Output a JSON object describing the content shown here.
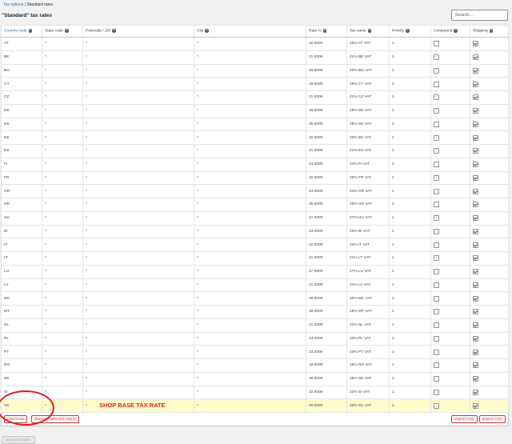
{
  "breadcrumb": {
    "parent": "Tax options",
    "separator": "|",
    "current": "Standard rates"
  },
  "title": "\"Standard\" tax rates",
  "search": {
    "placeholder": "Search..."
  },
  "columns": {
    "country": "Country code",
    "state": "State code",
    "postcode": "Postcode / ZIP",
    "city": "City",
    "rate": "Rate %",
    "name": "Tax name",
    "priority": "Priority",
    "compound": "Compound",
    "shipping": "Shipping"
  },
  "rows": [
    {
      "country": "AT",
      "state": "*",
      "postcode": "*",
      "city": "*",
      "rate": "20.0000",
      "name": "20% AT VAT",
      "priority": "1",
      "compound": false,
      "shipping": true
    },
    {
      "country": "BE",
      "state": "*",
      "postcode": "*",
      "city": "*",
      "rate": "21.0000",
      "name": "21% BE VAT",
      "priority": "1",
      "compound": false,
      "shipping": true
    },
    {
      "country": "BG",
      "state": "*",
      "postcode": "*",
      "city": "*",
      "rate": "20.0000",
      "name": "20% BG VAT",
      "priority": "1",
      "compound": false,
      "shipping": true
    },
    {
      "country": "CY",
      "state": "*",
      "postcode": "*",
      "city": "*",
      "rate": "19.0000",
      "name": "19% CY VAT",
      "priority": "1",
      "compound": false,
      "shipping": true
    },
    {
      "country": "CZ",
      "state": "*",
      "postcode": "*",
      "city": "*",
      "rate": "21.0000",
      "name": "21% CZ VAT",
      "priority": "1",
      "compound": false,
      "shipping": true
    },
    {
      "country": "DE",
      "state": "*",
      "postcode": "*",
      "city": "*",
      "rate": "19.0000",
      "name": "19% DE VAT",
      "priority": "1",
      "compound": false,
      "shipping": true
    },
    {
      "country": "DK",
      "state": "*",
      "postcode": "*",
      "city": "*",
      "rate": "25.0000",
      "name": "25% DK VAT",
      "priority": "1",
      "compound": false,
      "shipping": true
    },
    {
      "country": "EE",
      "state": "*",
      "postcode": "*",
      "city": "*",
      "rate": "20.0000",
      "name": "20% EE VAT",
      "priority": "1",
      "compound": false,
      "shipping": true
    },
    {
      "country": "ES",
      "state": "*",
      "postcode": "*",
      "city": "*",
      "rate": "21.0000",
      "name": "21% ES VAT",
      "priority": "1",
      "compound": false,
      "shipping": true
    },
    {
      "country": "FI",
      "state": "*",
      "postcode": "*",
      "city": "*",
      "rate": "24.0000",
      "name": "24% FI VAT",
      "priority": "1",
      "compound": false,
      "shipping": true
    },
    {
      "country": "FR",
      "state": "*",
      "postcode": "*",
      "city": "*",
      "rate": "20.0000",
      "name": "20% FR VAT",
      "priority": "1",
      "compound": false,
      "shipping": true
    },
    {
      "country": "GR",
      "state": "*",
      "postcode": "*",
      "city": "*",
      "rate": "24.0000",
      "name": "24% GR VAT",
      "priority": "1",
      "compound": false,
      "shipping": true
    },
    {
      "country": "HR",
      "state": "*",
      "postcode": "*",
      "city": "*",
      "rate": "25.0000",
      "name": "25% HR VAT",
      "priority": "1",
      "compound": false,
      "shipping": true
    },
    {
      "country": "HU",
      "state": "*",
      "postcode": "*",
      "city": "*",
      "rate": "27.0000",
      "name": "27% HU VAT",
      "priority": "1",
      "compound": false,
      "shipping": true
    },
    {
      "country": "IE",
      "state": "*",
      "postcode": "*",
      "city": "*",
      "rate": "23.0000",
      "name": "23% IE VAT",
      "priority": "1",
      "compound": false,
      "shipping": true
    },
    {
      "country": "IT",
      "state": "*",
      "postcode": "*",
      "city": "*",
      "rate": "22.0000",
      "name": "22% IT VAT",
      "priority": "1",
      "compound": false,
      "shipping": true
    },
    {
      "country": "LT",
      "state": "*",
      "postcode": "*",
      "city": "*",
      "rate": "21.0000",
      "name": "21% LT VAT",
      "priority": "1",
      "compound": false,
      "shipping": true
    },
    {
      "country": "LU",
      "state": "*",
      "postcode": "*",
      "city": "*",
      "rate": "17.0000",
      "name": "17% LU VAT",
      "priority": "1",
      "compound": false,
      "shipping": true
    },
    {
      "country": "LV",
      "state": "*",
      "postcode": "*",
      "city": "*",
      "rate": "21.0000",
      "name": "21% LV VAT",
      "priority": "1",
      "compound": false,
      "shipping": true
    },
    {
      "country": "MC",
      "state": "*",
      "postcode": "*",
      "city": "*",
      "rate": "20.0000",
      "name": "20% MC VAT",
      "priority": "1",
      "compound": false,
      "shipping": true
    },
    {
      "country": "MT",
      "state": "*",
      "postcode": "*",
      "city": "*",
      "rate": "18.0000",
      "name": "18% MT VAT",
      "priority": "1",
      "compound": false,
      "shipping": true
    },
    {
      "country": "NL",
      "state": "*",
      "postcode": "*",
      "city": "*",
      "rate": "21.0000",
      "name": "21% NL VAT",
      "priority": "1",
      "compound": false,
      "shipping": true
    },
    {
      "country": "PL",
      "state": "*",
      "postcode": "*",
      "city": "*",
      "rate": "23.0000",
      "name": "23% PL VAT",
      "priority": "1",
      "compound": false,
      "shipping": true
    },
    {
      "country": "PT",
      "state": "*",
      "postcode": "*",
      "city": "*",
      "rate": "23.0000",
      "name": "23% PT VAT",
      "priority": "1",
      "compound": false,
      "shipping": true
    },
    {
      "country": "RO",
      "state": "*",
      "postcode": "*",
      "city": "*",
      "rate": "19.0000",
      "name": "19% RO VAT",
      "priority": "1",
      "compound": false,
      "shipping": true
    },
    {
      "country": "SE",
      "state": "*",
      "postcode": "*",
      "city": "*",
      "rate": "25.0000",
      "name": "25% SE VAT",
      "priority": "1",
      "compound": false,
      "shipping": true
    },
    {
      "country": "SI",
      "state": "*",
      "postcode": "*",
      "city": "*",
      "rate": "22.0000",
      "name": "22% SI VAT",
      "priority": "1",
      "compound": false,
      "shipping": true
    },
    {
      "country": "SK",
      "state": "*",
      "postcode": "*",
      "city": "*",
      "rate": "20.0000",
      "name": "20% SK VAT",
      "priority": "1",
      "compound": false,
      "shipping": true,
      "highlighted": true
    }
  ],
  "footer": {
    "insert_row": "Insert row",
    "remove_rows": "Remove selected row(s)",
    "import_csv": "Import CSV",
    "export_csv": "Export CSV"
  },
  "annotation": {
    "label": "SHOP BASE TAX RATE"
  },
  "save_label": "Save changes",
  "colors": {
    "accent": "#2271b1",
    "highlight_row": "#fffbcc",
    "annotation": "#e02020",
    "danger": "#d63638"
  }
}
